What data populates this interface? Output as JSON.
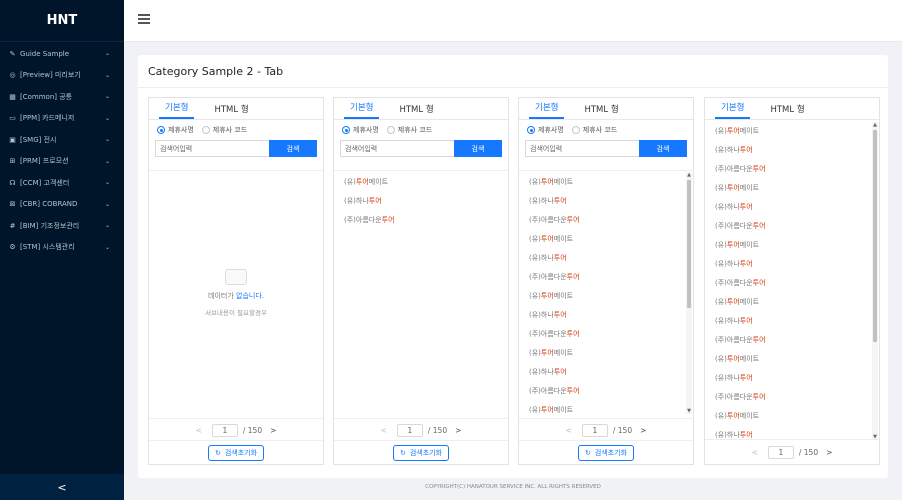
{
  "sidebar": {
    "logo": "HNT",
    "items": [
      {
        "icon": "puzzle-icon",
        "glyph": "✎",
        "label": "Guide Sample"
      },
      {
        "icon": "eye-icon",
        "glyph": "◎",
        "label": "[Preview] 미리보기"
      },
      {
        "icon": "grid-icon",
        "glyph": "▦",
        "label": "[Common] 공통"
      },
      {
        "icon": "card-icon",
        "glyph": "▭",
        "label": "[PPM] 카드메니저"
      },
      {
        "icon": "display-icon",
        "glyph": "▣",
        "label": "[SMG] 전시"
      },
      {
        "icon": "gift-icon",
        "glyph": "⊞",
        "label": "[PRM] 프로모션"
      },
      {
        "icon": "headset-icon",
        "glyph": "☊",
        "label": "[CCM] 고객센터"
      },
      {
        "icon": "tag-icon",
        "glyph": "⊠",
        "label": "[CBR] COBRAND"
      },
      {
        "icon": "hash-icon",
        "glyph": "#",
        "label": "[BIM] 기조정보관리"
      },
      {
        "icon": "settings-icon",
        "glyph": "⚙",
        "label": "[STM] 시스템관리"
      }
    ],
    "collapse": "<"
  },
  "page_title": "Category Sample 2 - Tab",
  "panel": {
    "tab_basic": "기본형",
    "tab_html": "HTML 형",
    "radio_name": "제휴사명",
    "radio_code": "제휴사 코드",
    "search_placeholder": "검색어입력",
    "search_button": "검색",
    "page_current": "1",
    "page_total": "/ 150",
    "reset": "검색초기화"
  },
  "empty": {
    "line1_pre": "데이터가 ",
    "line1_hl": "없습니다.",
    "line2": "서브내용이 필요할경우"
  },
  "list_short": [
    {
      "prefix": "(유)",
      "hl": "투어",
      "suffix": "메이트"
    },
    {
      "prefix": "(유)하나",
      "hl": "투어",
      "suffix": ""
    },
    {
      "prefix": "(주)아름다운",
      "hl": "투어",
      "suffix": ""
    }
  ],
  "list_long": [
    {
      "prefix": "(유)",
      "hl": "투어",
      "suffix": "메이트"
    },
    {
      "prefix": "(유)하나",
      "hl": "투어",
      "suffix": ""
    },
    {
      "prefix": "(주)아름다운",
      "hl": "투어",
      "suffix": ""
    },
    {
      "prefix": "(유)",
      "hl": "투어",
      "suffix": "메이트"
    },
    {
      "prefix": "(유)하나",
      "hl": "투어",
      "suffix": ""
    },
    {
      "prefix": "(주)아름다운",
      "hl": "투어",
      "suffix": ""
    },
    {
      "prefix": "(유)",
      "hl": "투어",
      "suffix": "메이트"
    },
    {
      "prefix": "(유)하나",
      "hl": "투어",
      "suffix": ""
    },
    {
      "prefix": "(주)아름다운",
      "hl": "투어",
      "suffix": ""
    },
    {
      "prefix": "(유)",
      "hl": "투어",
      "suffix": "메이트"
    },
    {
      "prefix": "(유)하나",
      "hl": "투어",
      "suffix": ""
    },
    {
      "prefix": "(주)아름다운",
      "hl": "투어",
      "suffix": ""
    },
    {
      "prefix": "(유)",
      "hl": "투어",
      "suffix": "메이트"
    }
  ],
  "list_tall": [
    {
      "prefix": "(유)",
      "hl": "투어",
      "suffix": "메이트"
    },
    {
      "prefix": "(유)하나",
      "hl": "투어",
      "suffix": ""
    },
    {
      "prefix": "(주)아름다운",
      "hl": "투어",
      "suffix": ""
    },
    {
      "prefix": "(유)",
      "hl": "투어",
      "suffix": "메이트"
    },
    {
      "prefix": "(유)하나",
      "hl": "투어",
      "suffix": ""
    },
    {
      "prefix": "(주)아름다운",
      "hl": "투어",
      "suffix": ""
    },
    {
      "prefix": "(유)",
      "hl": "투어",
      "suffix": "메이트"
    },
    {
      "prefix": "(유)하나",
      "hl": "투어",
      "suffix": ""
    },
    {
      "prefix": "(주)아름다운",
      "hl": "투어",
      "suffix": ""
    },
    {
      "prefix": "(유)",
      "hl": "투어",
      "suffix": "메이트"
    },
    {
      "prefix": "(유)하나",
      "hl": "투어",
      "suffix": ""
    },
    {
      "prefix": "(주)아름다운",
      "hl": "투어",
      "suffix": ""
    },
    {
      "prefix": "(유)",
      "hl": "투어",
      "suffix": "메이트"
    },
    {
      "prefix": "(유)하나",
      "hl": "투어",
      "suffix": ""
    },
    {
      "prefix": "(주)아름다운",
      "hl": "투어",
      "suffix": ""
    },
    {
      "prefix": "(유)",
      "hl": "투어",
      "suffix": "메이트"
    },
    {
      "prefix": "(유)하나",
      "hl": "투어",
      "suffix": ""
    }
  ],
  "footer": "COPYRIGHT(C) HANATOUR SERVICE INC. ALL RIGHTS RESERVED",
  "colors": {
    "accent": "#1677ff",
    "highlight": "#d4380d",
    "sidebar": "#001529"
  }
}
